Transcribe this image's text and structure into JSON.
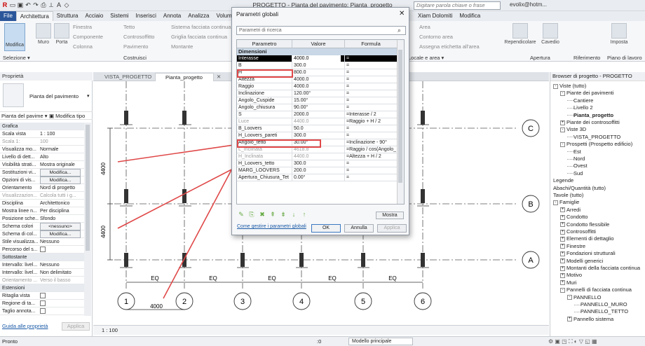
{
  "window": {
    "title": "PROGETTO - Pianta del pavimento: Pianta_progetto",
    "search_placeholder": "Digitare parola chiave o frase",
    "user": "evolix@hotm..."
  },
  "ribbon_tabs": [
    "File",
    "Architettura",
    "Struttura",
    "Acciaio",
    "Sistemi",
    "Inserisci",
    "Annota",
    "Analizza",
    "Volumetr",
    "Xiam Dolomiti",
    "Modifica"
  ],
  "ribbon": {
    "modify": "Modifica",
    "muro": "Muro",
    "porta": "Porta",
    "items": [
      "Finestra",
      "Componente",
      "Colonna",
      "Tetto",
      "Controsoffitto",
      "Pavimento",
      "Sistema facciata continua",
      "Griglia facciata continua",
      "Montante"
    ],
    "right_items": [
      "Area",
      "Contorno area",
      "Assegna etichetta  all'area"
    ],
    "right_buttons": [
      "Rependicolare",
      "Cavedio",
      "Imposta"
    ],
    "panels": {
      "selezione": "Selezione",
      "costruisci": "Costruisci",
      "locale_area": "Locale e area",
      "apertura": "Apertura",
      "riferimento": "Riferimento",
      "piano": "Piano di lavoro"
    }
  },
  "properties": {
    "header": "Proprietà",
    "type_name": "Pianta del pavimento",
    "type_combo": "Pianta del pavime",
    "edit_type": "Modifica tipo",
    "rows": [
      {
        "k": "Grafica",
        "v": "",
        "section": true
      },
      {
        "k": "Scala vista",
        "v": "1 : 100"
      },
      {
        "k": "Scala  1:",
        "v": "100",
        "grey": true
      },
      {
        "k": "Visualizza mo...",
        "v": "Normale"
      },
      {
        "k": "Livello di dett...",
        "v": "Alto"
      },
      {
        "k": "Visibilità strati...",
        "v": "Mostra originale"
      },
      {
        "k": "Sostituzioni vi...",
        "v": "Modifica...",
        "btn": true
      },
      {
        "k": "Opzioni di vis...",
        "v": "Modifica...",
        "btn": true
      },
      {
        "k": "Orientamento",
        "v": "Nord di progetto"
      },
      {
        "k": "Visualizzazion...",
        "v": "Calcola tutti i g...",
        "grey": true
      },
      {
        "k": "Disciplina",
        "v": "Architettonico"
      },
      {
        "k": "Mostra linee n...",
        "v": "Per disciplina"
      },
      {
        "k": "Posizione sche...",
        "v": "Sfondo"
      },
      {
        "k": "Schema colori",
        "v": "<nessuno>",
        "btn": true
      },
      {
        "k": "Schema di col...",
        "v": "Modifica...",
        "btn": true
      },
      {
        "k": "Stile visualizza...",
        "v": "Nessuno"
      },
      {
        "k": "Percorso del s...",
        "v": "",
        "chk": true
      },
      {
        "k": "Sottostante",
        "v": "",
        "section": true
      },
      {
        "k": "Intervallo: livel...",
        "v": "Nessuno"
      },
      {
        "k": "Intervallo: livel...",
        "v": "Non delimitato"
      },
      {
        "k": "Orientamento ...",
        "v": "Verso il basso",
        "grey": true
      },
      {
        "k": "Estensioni",
        "v": "",
        "section": true
      },
      {
        "k": "Ritaglia vista",
        "v": "",
        "chk": true
      },
      {
        "k": "Regione di ta...",
        "v": "",
        "chk": true
      },
      {
        "k": "Taglio annota...",
        "v": "",
        "chk": true
      }
    ],
    "help_link": "Guida alle proprietà",
    "apply": "Applica"
  },
  "view_tabs": [
    {
      "label": "VISTA_PROGETTO"
    },
    {
      "label": "Pianta_progetto"
    }
  ],
  "view_close": "✕",
  "canvas": {
    "grid_numbers": [
      "1",
      "2",
      "3",
      "4",
      "5",
      "6"
    ],
    "grid_letters": [
      "C",
      "B",
      "A"
    ],
    "eq_labels": [
      "EQ",
      "EQ",
      "EQ",
      "EQ",
      "EQ"
    ],
    "dim_vertical": [
      "4400",
      "4400"
    ],
    "dim_horizontal": "4000"
  },
  "scale_label": "1 : 100",
  "browser": {
    "header": "Browser di progetto - PROGETTO",
    "items": [
      {
        "t": "Viste (tutto)",
        "lvl": 0,
        "tg": "-"
      },
      {
        "t": "Piante dei pavimenti",
        "lvl": 1,
        "tg": "-"
      },
      {
        "t": "Cantiere",
        "lvl": 2
      },
      {
        "t": "Livello 2",
        "lvl": 2
      },
      {
        "t": "Pianta_progetto",
        "lvl": 2,
        "bold": true
      },
      {
        "t": "Piante dei controsoffitti",
        "lvl": 1,
        "tg": "+"
      },
      {
        "t": "Viste 3D",
        "lvl": 1,
        "tg": "-"
      },
      {
        "t": "VISTA_PROGETTO",
        "lvl": 2
      },
      {
        "t": "Prospetti (Prospetto edificio)",
        "lvl": 1,
        "tg": "-"
      },
      {
        "t": "Est",
        "lvl": 2
      },
      {
        "t": "Nord",
        "lvl": 2
      },
      {
        "t": "Ovest",
        "lvl": 2
      },
      {
        "t": "Sud",
        "lvl": 2
      },
      {
        "t": "Legende",
        "lvl": 0
      },
      {
        "t": "Abachi/Quantità (tutto)",
        "lvl": 0
      },
      {
        "t": "Tavole (tutto)",
        "lvl": 0
      },
      {
        "t": "Famiglie",
        "lvl": 0,
        "tg": "-"
      },
      {
        "t": "Arredi",
        "lvl": 1,
        "tg": "+"
      },
      {
        "t": "Condotto",
        "lvl": 1,
        "tg": "+"
      },
      {
        "t": "Condotto flessibile",
        "lvl": 1,
        "tg": "+"
      },
      {
        "t": "Controsoffitti",
        "lvl": 1,
        "tg": "+"
      },
      {
        "t": "Elementi di dettaglio",
        "lvl": 1,
        "tg": "+"
      },
      {
        "t": "Finestre",
        "lvl": 1,
        "tg": "+"
      },
      {
        "t": "Fondazioni strutturali",
        "lvl": 1,
        "tg": "+"
      },
      {
        "t": "Modelli generici",
        "lvl": 1,
        "tg": "+"
      },
      {
        "t": "Montanti della facciata continua",
        "lvl": 1,
        "tg": "+"
      },
      {
        "t": "Motivo",
        "lvl": 1,
        "tg": "+"
      },
      {
        "t": "Muri",
        "lvl": 1,
        "tg": "+"
      },
      {
        "t": "Pannelli di facciata continua",
        "lvl": 1,
        "tg": "-"
      },
      {
        "t": "PANNELLO",
        "lvl": 2,
        "tg": "-"
      },
      {
        "t": "PANNELLO_MURO",
        "lvl": 3
      },
      {
        "t": "PANNELLO_TETTO",
        "lvl": 3
      },
      {
        "t": "Pannello sistema",
        "lvl": 2,
        "tg": "+"
      }
    ]
  },
  "status": {
    "text": "Pronto",
    "zero": ":0",
    "model": "Modello principale"
  },
  "dialog": {
    "title": "Parametri globali",
    "search_placeholder": "Parametri di ricerca",
    "columns": [
      "Parametro",
      "Valore",
      "Formula"
    ],
    "section": "Dimensioni",
    "rows": [
      {
        "p": "Interasse",
        "v": "4000.0",
        "f": "=",
        "sel": true
      },
      {
        "p": "B",
        "v": "300.0",
        "f": "="
      },
      {
        "p": "H",
        "v": "800.0",
        "f": "="
      },
      {
        "p": "Altezza",
        "v": "4000.0",
        "f": "="
      },
      {
        "p": "Raggio",
        "v": "4000.0",
        "f": "="
      },
      {
        "p": "Inclinazione",
        "v": "120.00°",
        "f": "="
      },
      {
        "p": "Angolo_Cuspide",
        "v": "15.00°",
        "f": "="
      },
      {
        "p": "Angolo_chiusura",
        "v": "90.00°",
        "f": "="
      },
      {
        "p": "S",
        "v": "2000.0",
        "f": "=Interasse / 2"
      },
      {
        "p": "Luce",
        "v": "4400.0",
        "f": "=Raggio + H / 2",
        "grey": true
      },
      {
        "p": "B_Loovers",
        "v": "50.0",
        "f": "="
      },
      {
        "p": "H_Loovers_pareti",
        "v": "300.0",
        "f": "="
      },
      {
        "p": "Angolo_tetto",
        "v": "30.00°",
        "f": "=Inclinazione - 90°"
      },
      {
        "p": "L_Inclinata",
        "v": "4618.8",
        "f": "=Raggio / cos(Angolo_",
        "grey": true
      },
      {
        "p": "H_Inclinata",
        "v": "4400.0",
        "f": "=Altezza + H / 2",
        "grey": true
      },
      {
        "p": "H_Loovers_tetto",
        "v": "300.0",
        "f": "="
      },
      {
        "p": "MARG_LOOVERS",
        "v": "200.0",
        "f": "="
      },
      {
        "p": "Apertura_Chiusura_Tett",
        "v": "0.00°",
        "f": "="
      }
    ],
    "tools": [
      "✎",
      "⎘",
      "✖",
      "⇞",
      "⇟",
      "↓",
      "↑"
    ],
    "show_button": "Mostra",
    "manage_link": "Come gestire i parametri globali",
    "ok": "OK",
    "cancel": "Annulla",
    "apply": "Applica"
  }
}
